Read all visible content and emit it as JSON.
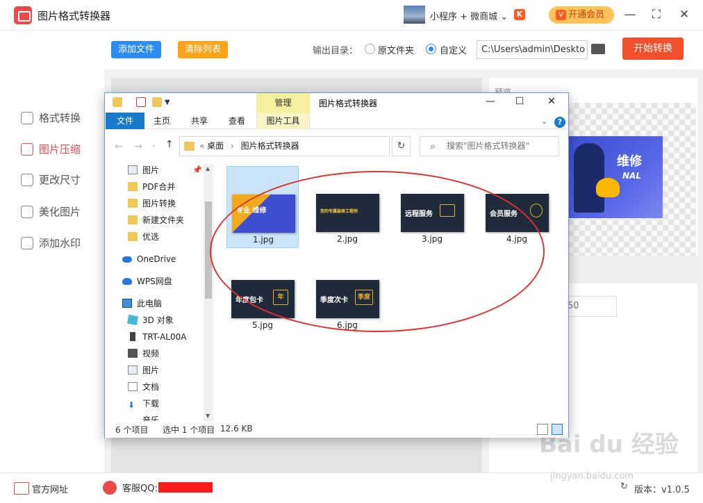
{
  "app": {
    "title": "图片格式转换器",
    "mini_program": "小程序 + 微商城",
    "vip_label": "开通会员",
    "window_controls": [
      "minimize-icon",
      "maximize-icon",
      "close-icon"
    ]
  },
  "toolbar": {
    "add_files": "添加文件",
    "clear_list": "清除列表",
    "output_label": "输出目录：",
    "radio_original": "原文件夹",
    "radio_custom": "自定义",
    "selected_output": "自定义",
    "output_path": "C:\\Users\\admin\\Deskto",
    "start": "开始转换"
  },
  "sidebar": {
    "items": [
      {
        "label": "格式转换",
        "icon": "convert-icon"
      },
      {
        "label": "图片压缩",
        "icon": "compress-icon",
        "active": true
      },
      {
        "label": "更改尺寸",
        "icon": "resize-icon"
      },
      {
        "label": "美化图片",
        "icon": "beautify-icon"
      },
      {
        "label": "添加水印",
        "icon": "watermark-icon"
      }
    ]
  },
  "background": {
    "preview_label": "预览",
    "quality_value": "50",
    "preview_image_text1": "维修",
    "preview_image_text2": "NAL"
  },
  "footer": {
    "site": "官方网址",
    "qq": "客服QQ:",
    "version": "版本：v1.0.5"
  },
  "watermark": {
    "main": "Bai du 经验",
    "sub": "jingyan.baidu.com"
  },
  "explorer": {
    "manage_tab": "管理",
    "title": "图片格式转换器",
    "ribbon_tabs": [
      "文件",
      "主页",
      "共享",
      "查看",
      "图片工具"
    ],
    "address_parts": [
      "桌面",
      "图片格式转换器"
    ],
    "search_placeholder": "搜索\"图片格式转换器\"",
    "nav": [
      {
        "label": "图片",
        "icon": "pictures-icon"
      },
      {
        "label": "PDF合并",
        "icon": "folder-icon"
      },
      {
        "label": "图片转换",
        "icon": "folder-icon"
      },
      {
        "label": "新建文件夹",
        "icon": "folder-icon"
      },
      {
        "label": "优选",
        "icon": "folder-icon"
      },
      {
        "label": "OneDrive",
        "icon": "onedrive-icon"
      },
      {
        "label": "WPS网盘",
        "icon": "wps-cloud-icon"
      },
      {
        "label": "此电脑",
        "icon": "this-pc-icon"
      },
      {
        "label": "3D 对象",
        "icon": "3d-objects-icon"
      },
      {
        "label": "TRT-AL00A",
        "icon": "phone-icon"
      },
      {
        "label": "视频",
        "icon": "videos-icon"
      },
      {
        "label": "图片",
        "icon": "pictures-icon"
      },
      {
        "label": "文档",
        "icon": "documents-icon"
      },
      {
        "label": "下载",
        "icon": "downloads-icon"
      },
      {
        "label": "音乐",
        "icon": "music-icon"
      }
    ],
    "files": [
      {
        "name": "1.jpg",
        "selected": true,
        "thumb_text": "专业 维修"
      },
      {
        "name": "2.jpg",
        "thumb_text": "您的专属装修工程师"
      },
      {
        "name": "3.jpg",
        "thumb_text": "远程服务"
      },
      {
        "name": "4.jpg",
        "thumb_text": "会员服务"
      },
      {
        "name": "5.jpg",
        "thumb_text": "年度包卡",
        "badge": "年"
      },
      {
        "name": "6.jpg",
        "thumb_text": "季度次卡",
        "badge": "季度"
      }
    ],
    "status": {
      "count": "6 个项目",
      "selected": "选中 1 个项目",
      "size": "12.6 KB"
    }
  }
}
